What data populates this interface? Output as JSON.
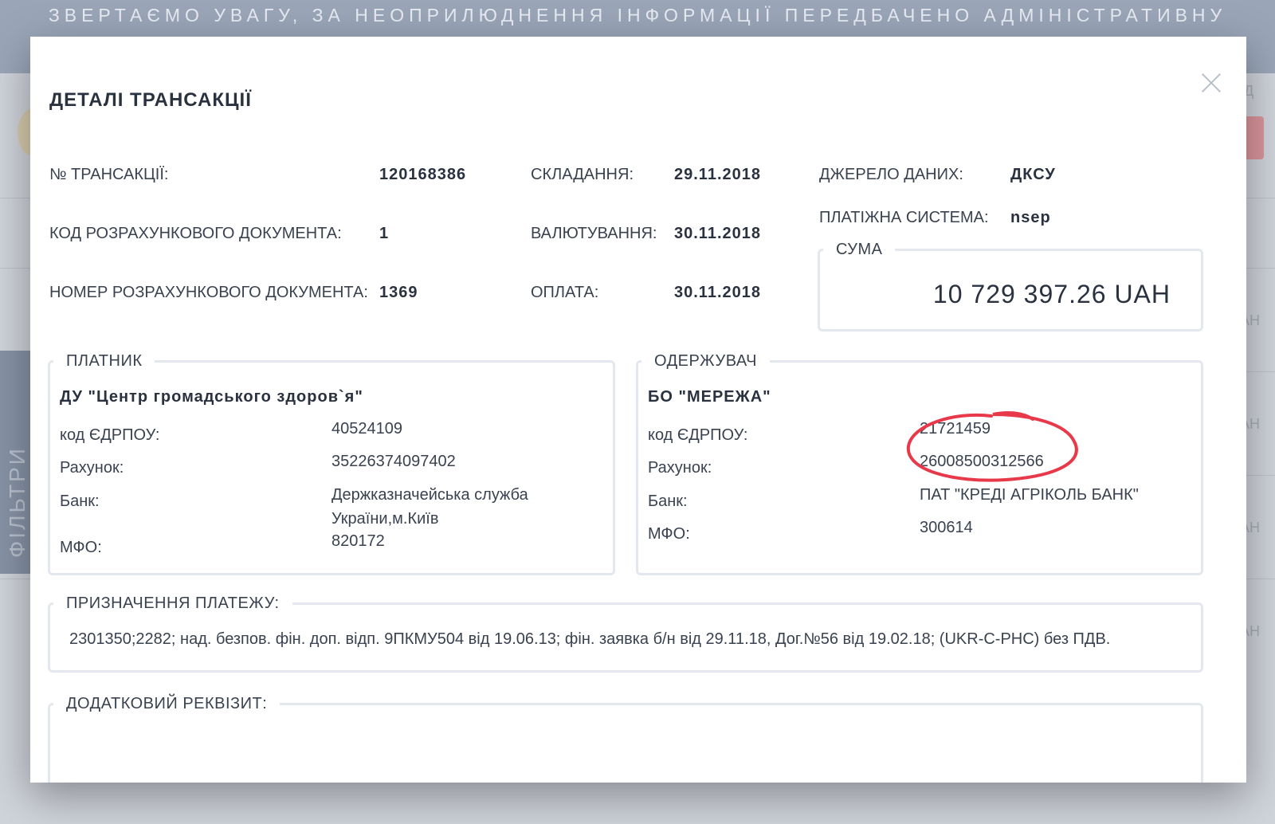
{
  "background": {
    "banner_text": "ЗВЕРТАЄМО УВАГУ, ЗА НЕОПРИЛЮДНЕННЯ ІНФОРМАЦІЇ ПЕРЕДБАЧЕНО АДМІНІСТРАТИВНУ",
    "filters_label": "ФІЛЬТРИ",
    "right_fragments": [
      "ІД",
      "АН",
      "АН",
      "АН",
      "АН"
    ]
  },
  "modal": {
    "title": "ДЕТАЛІ ТРАНСАКЦІЇ",
    "close_icon": "close-icon",
    "fields": {
      "transaction_no_label": "№ ТРАНСАКЦІЇ:",
      "transaction_no": "120168386",
      "doc_code_label": "КОД РОЗРАХУНКОВОГО ДОКУМЕНТА:",
      "doc_code": "1",
      "doc_number_label": "НОМЕР РОЗРАХУНКОВОГО ДОКУМЕНТА:",
      "doc_number": "1369",
      "created_label": "СКЛАДАННЯ:",
      "created": "29.11.2018",
      "value_date_label": "ВАЛЮТУВАННЯ:",
      "value_date": "30.11.2018",
      "payment_label": "ОПЛАТА:",
      "payment": "30.11.2018",
      "source_label": "ДЖЕРЕЛО ДАНИХ:",
      "source": "ДКСУ",
      "system_label": "ПЛАТІЖНА СИСТЕМА:",
      "system": "nsep"
    },
    "sum": {
      "label": "СУМА",
      "amount": "10 729 397.26 UAH"
    },
    "payer": {
      "legend": "ПЛАТНИК",
      "name": "ДУ \"Центр громадського здоров`я\"",
      "edrpou_label": "код ЄДРПОУ:",
      "edrpou": "40524109",
      "account_label": "Рахунок:",
      "account": "35226374097402",
      "bank_label": "Банк:",
      "bank": "Держказначейська служба України,м.Київ",
      "mfo_label": "МФО:",
      "mfo": "820172"
    },
    "receiver": {
      "legend": "ОДЕРЖУВАЧ",
      "name": "БО \"МЕРЕЖА\"",
      "edrpou_label": "код ЄДРПОУ:",
      "edrpou": "21721459",
      "account_label": "Рахунок:",
      "account": "26008500312566",
      "bank_label": "Банк:",
      "bank": "ПАТ \"КРЕДІ АГРІКОЛЬ БАНК\"",
      "mfo_label": "МФО:",
      "mfo": "300614"
    },
    "purpose": {
      "legend": "ПРИЗНАЧЕННЯ ПЛАТЕЖУ:",
      "text": "2301350;2282; над. безпов. фін. доп. відп. 9ПКМУ504 від 19.06.13; фін. заявка б/н від 29.11.18, Дог.№56 від 19.02.18; (UKR-C-PHC) без ПДВ."
    },
    "extra": {
      "legend": "ДОДАТКОВИЙ РЕКВІЗИТ:",
      "text": ""
    }
  },
  "colors": {
    "annotation": "#e8394a",
    "border": "#e3e7ee",
    "text": "#2a3240"
  }
}
